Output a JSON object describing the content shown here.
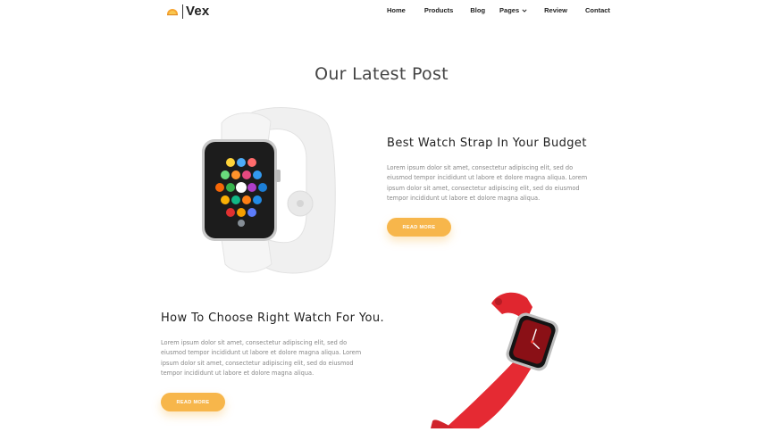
{
  "brand": {
    "name": "Vex",
    "accent": "#f7b64b"
  },
  "nav": {
    "home": "Home",
    "products": "Products",
    "blog": "Blog",
    "pages": "Pages",
    "review": "Review",
    "contact": "Contact"
  },
  "section": {
    "title": "Our Latest Post"
  },
  "posts": [
    {
      "title": "Best Watch Strap In Your Budget",
      "body": "Lorem ipsum dolor sit amet, consectetur adipiscing elit, sed do eiusmod tempor incididunt ut labore et dolore magna aliqua. Lorem ipsum dolor sit amet, consectetur adipiscing elit, sed do eiusmod tempor incididunt ut labore et dolore magna aliqua.",
      "button": "READ MORE"
    },
    {
      "title": "How To Choose Right Watch For You.",
      "body": "Lorem ipsum dolor sit amet, consectetur adipiscing elit, sed do eiusmod tempor incididunt ut labore et dolore magna aliqua. Lorem ipsum dolor sit amet, consectetur adipiscing elit, sed do eiusmod tempor incididunt ut labore et dolore magna aliqua.",
      "button": "READ MORE"
    }
  ],
  "icons": {
    "logo": "half-sun-logo-icon",
    "pages_dropdown": "chevron-down-icon"
  }
}
